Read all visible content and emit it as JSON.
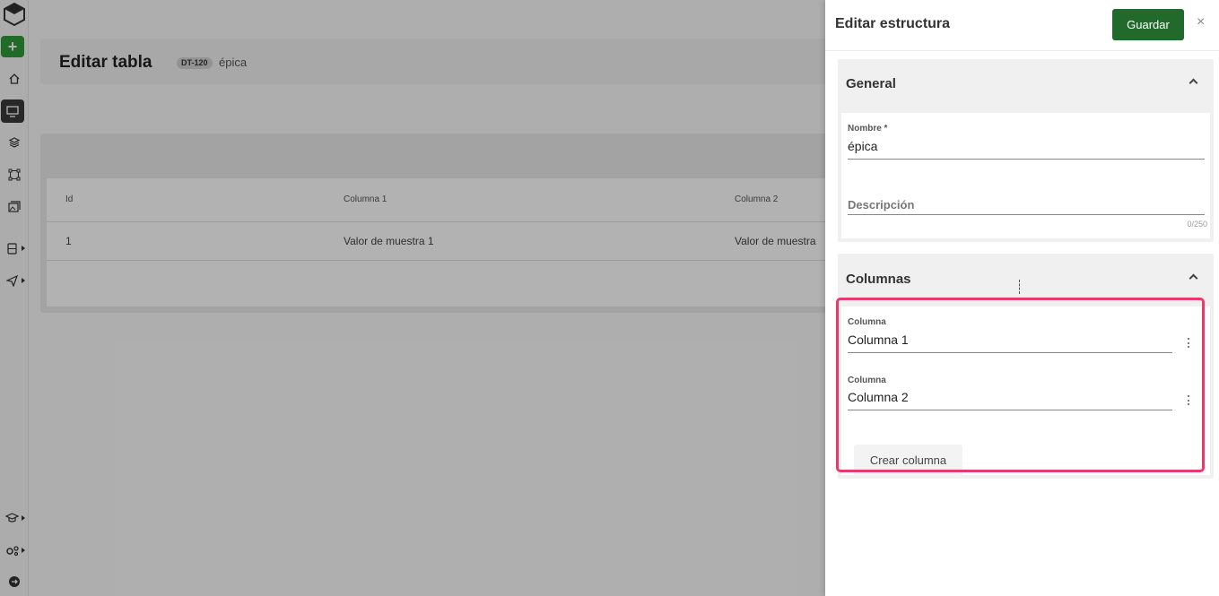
{
  "sidebar": {
    "add_label": "+",
    "icons": [
      "logo-hexagon-icon",
      "home-icon",
      "monitor-icon",
      "layers-icon",
      "vector-nodes-icon",
      "gallery-icon",
      "database-icon",
      "send-icon",
      "graduation-cap-icon",
      "gears-icon",
      "logout-icon"
    ]
  },
  "page": {
    "title": "Editar tabla",
    "badge": "DT-120",
    "name": "épica"
  },
  "table": {
    "headers": [
      "Id",
      "Columna 1",
      "Columna 2"
    ],
    "rows": [
      [
        "1",
        "Valor de muestra 1",
        "Valor de muestra"
      ]
    ]
  },
  "drawer": {
    "title": "Editar estructura",
    "save_label": "Guardar",
    "close_label": "×",
    "general": {
      "title": "General",
      "name_label": "Nombre *",
      "name_value": "épica",
      "description_placeholder": "Descripción",
      "counter": "0/250"
    },
    "columns": {
      "title": "Columnas",
      "items": [
        {
          "label": "Columna",
          "value": "Columna 1"
        },
        {
          "label": "Columna",
          "value": "Columna 2"
        }
      ],
      "create_label": "Crear columna"
    }
  },
  "colors": {
    "primary_green": "#226a2c",
    "add_green": "#2e9a3a",
    "highlight": "#e63b6e"
  }
}
